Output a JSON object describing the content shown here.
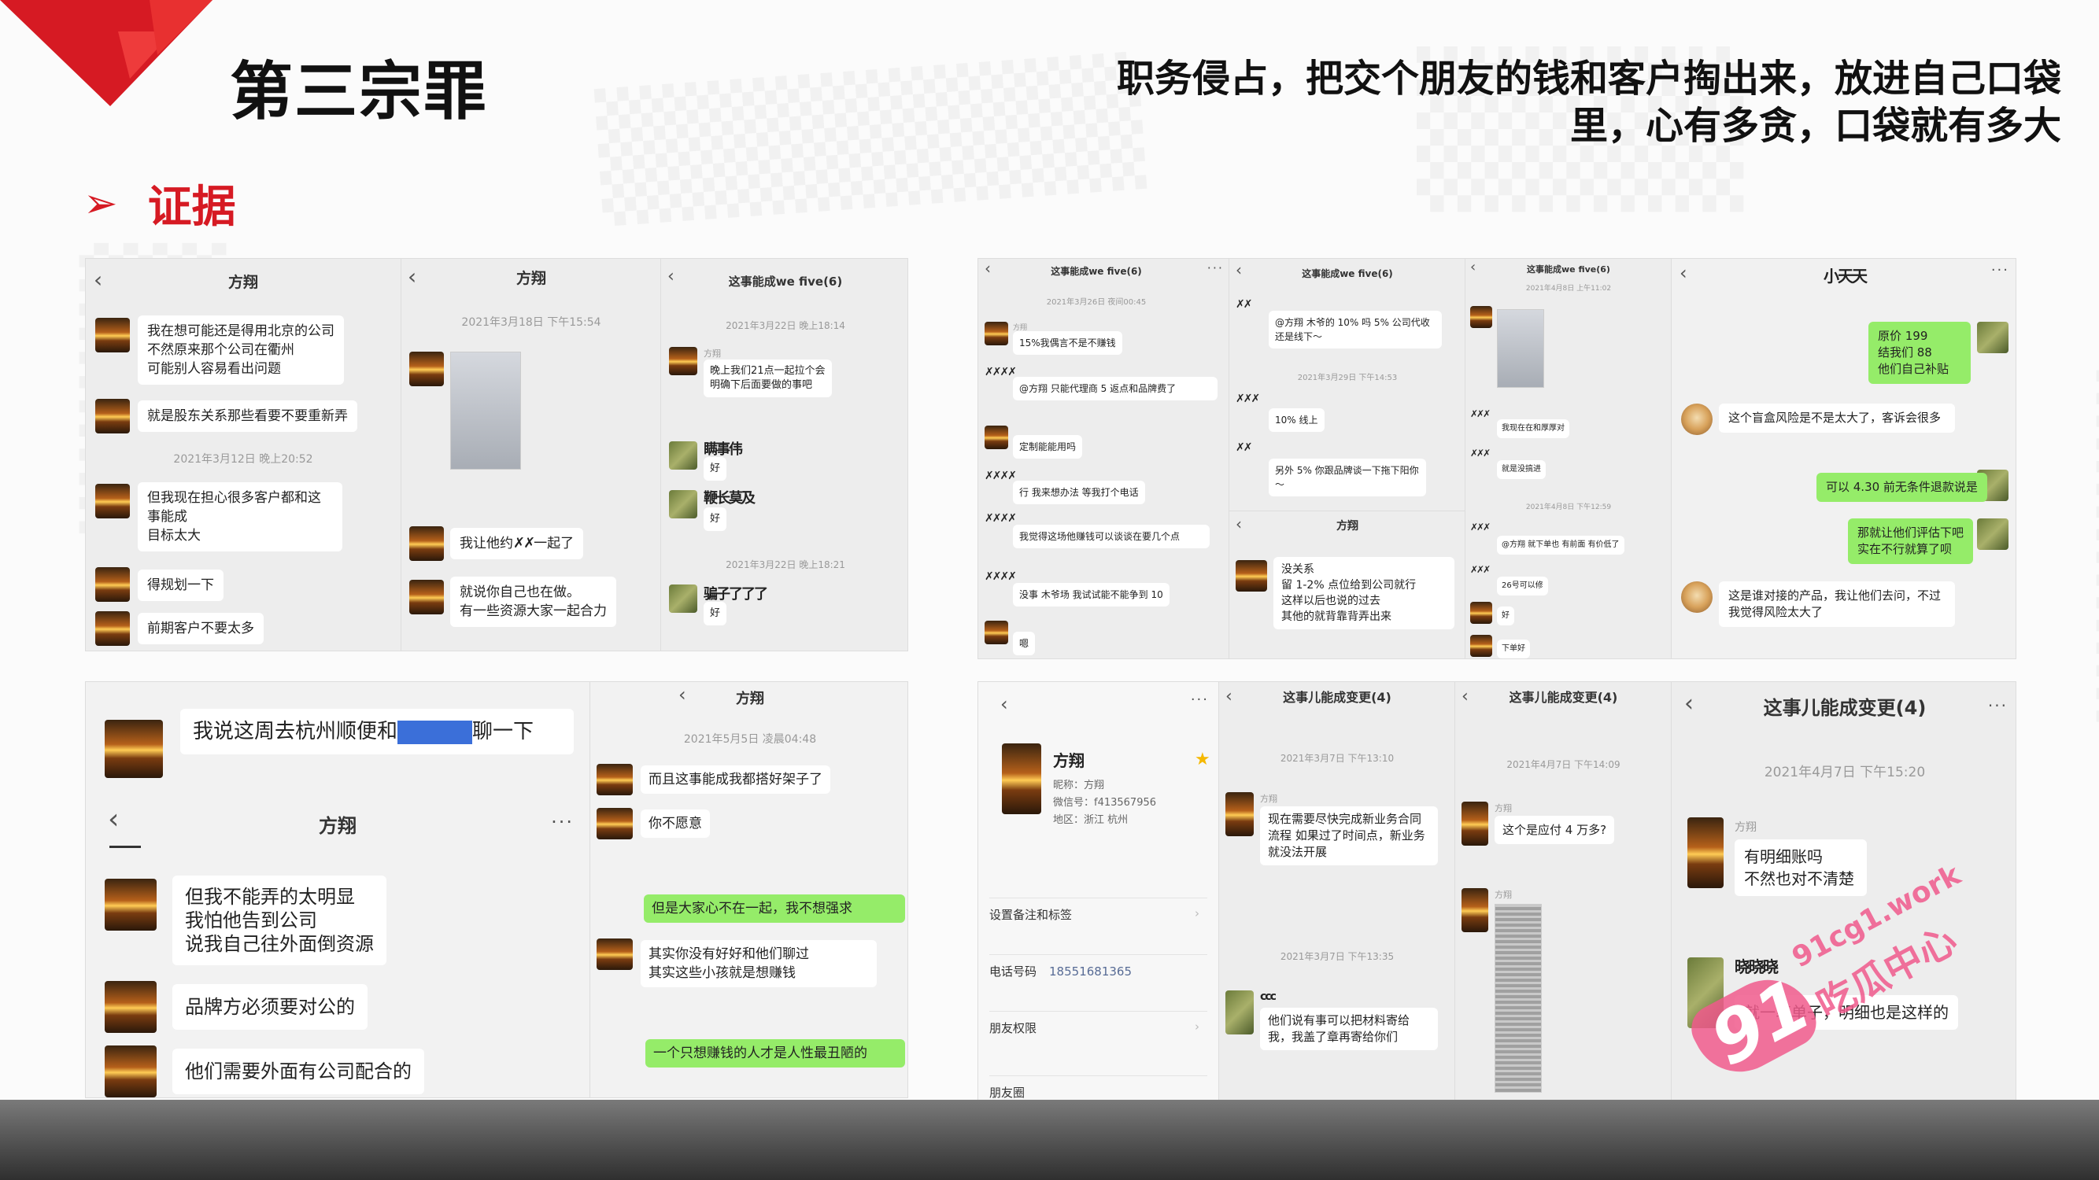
{
  "slide": {
    "title": "第三宗罪",
    "subtitle_line1": "职务侵占，把交个朋友的钱和客户掏出来，放进自己口袋",
    "subtitle_line2": "里，心有多贪，口袋就有多大",
    "evidence_label": "证据",
    "accent_color": "#d61a23"
  },
  "watermark": {
    "site": "91cg1.work",
    "brand": "吃瓜中心",
    "number": "91"
  },
  "icons": {
    "back": "chevron-left-icon",
    "more": "more-icon",
    "star": "star-icon",
    "pin": "pin-icon",
    "chevron": "chevron-right-icon"
  },
  "panel1": {
    "chat1": {
      "title": "方翔",
      "msgs": [
        "我在想可能还是得用北京的公司\n不然原来那个公司在衢州\n可能别人容易看出问题",
        "就是股东关系那些看要不要重新弄",
        "但我现在担心很多客户都和这事能成\n目标太大",
        "得规划一下",
        "前期客户不要太多"
      ],
      "time": "2021年3月12日 晚上20:52"
    },
    "chat2": {
      "title": "方翔",
      "time": "2021年3月18日 下午15:54",
      "msg1_a": "我让他约",
      "msg1_b": "一起了",
      "msg2": "就说你自己也在做。\n有一些资源大家一起合力"
    },
    "chat3": {
      "title": "这事能成we five(6)",
      "time1": "2021年3月22日 晚上18:14",
      "name": "方翔",
      "msg1": "晚上我们21点一起拉个会\n明确下后面要做的事吧",
      "scribble1": "瞒事伟",
      "ok": "好",
      "time2": "2021年3月22日 晚上18:21",
      "scribble2": "鞭长莫及",
      "scribble3": "骗子了了了"
    }
  },
  "panel2": {
    "chat1": {
      "title": "这事能成we five(6)",
      "time": "2021年3月26日 夜间00:45",
      "name": "方翔",
      "msgs": [
        "15%我偶言不是不赚钱",
        "@方翔 只能代理商 5 返点和品牌费了",
        "定制能能用吗",
        "行 我来想办法 等我打个电话",
        "我觉得这场他赚钱可以谈谈在要几个点",
        "没事 木爷场 我试试能不能争到 10",
        "嗯"
      ]
    },
    "chat2": {
      "title": "这事能成we five(6)",
      "msgs": [
        "@方翔 木爷的 10% 吗 5% 公司代收还是线下～",
        "10% 线上",
        "另外 5% 你跟品牌谈一下拖下阳你～"
      ],
      "time": "2021年3月29日 下午14:53"
    },
    "chat3": {
      "title": "这事能成we five(6)",
      "time1": "2021年4月8日 上午11:02",
      "msgs": [
        "我现在在和厚厚对",
        "就是没搞进",
        "@方翔 就下单也 有前面 有价低了",
        "26号可以修",
        "好",
        "下单好"
      ],
      "time2": "2021年4月8日 下午12:59"
    },
    "chat4": {
      "title": "方翔",
      "msg": "没关系\n留 1-2% 点位给到公司就行\n这样以后也说的过去\n其他的就背靠背弄出来"
    },
    "chat5": {
      "title": "小天天",
      "msgs": [
        "原价 199\n结我们 88\n他们自己补贴",
        "这个盲盒风险是不是太大了，客诉会很多",
        "可以 4.30 前无条件退款说是",
        "那就让他们评估下吧\n实在不行就算了呗",
        "这是谁对接的产品，我让他们去问，不过我觉得风险太大了"
      ]
    }
  },
  "panel3": {
    "chat1": {
      "msg_a": "我说这周去杭州顺便和",
      "msg_b": "聊一下"
    },
    "chat2": {
      "title": "方翔",
      "msgs": [
        "但我不能弄的太明显\n我怕他告到公司\n说我自己往外面倒资源",
        "品牌方必须要对公的",
        "他们需要外面有公司配合的"
      ]
    },
    "chat3": {
      "title": "方翔",
      "time": "2021年5月5日 凌晨04:48",
      "msgs": [
        "而且这事能成我都搭好架子了",
        "你不愿意",
        "但是大家心不在一起，我不想强求",
        "其实你没有好好和他们聊过\n其实这些小孩就是想赚钱",
        "一个只想赚钱的人才是人性最丑陋的"
      ]
    }
  },
  "panel4": {
    "profile": {
      "name": "方翔",
      "nickname": "昵称：方翔",
      "wechat_id": "微信号：f413567956",
      "region": "地区：浙江  杭州",
      "rows": [
        "设置备注和标签",
        "电话号码",
        "朋友权限",
        "朋友圈"
      ],
      "phone": "18551681365"
    },
    "chat1": {
      "title": "这事儿能成变更(4)",
      "time1": "2021年3月7日 下午13:10",
      "name": "方翔",
      "msg1": "现在需要尽快完成新业务合同流程 如果过了时间点，新业务就没法开展",
      "time2": "2021年3月7日 下午13:35",
      "name2": "ccc",
      "msg2": "他们说有事可以把材料寄给我，我盖了章再寄给你们"
    },
    "chat2": {
      "title": "这事儿能成变更(4)",
      "time": "2021年4月7日 下午14:09",
      "name": "方翔",
      "msg": "这个是应付 4 万多?"
    },
    "chat3": {
      "title": "这事儿能成变更(4)",
      "time": "2021年4月7日 下午15:20",
      "name": "方翔",
      "msg1": "有明细账吗\n不然也对不清楚",
      "scribble": "晓晓晓",
      "msg2": "就一笔单子，明细也是这样的"
    }
  }
}
